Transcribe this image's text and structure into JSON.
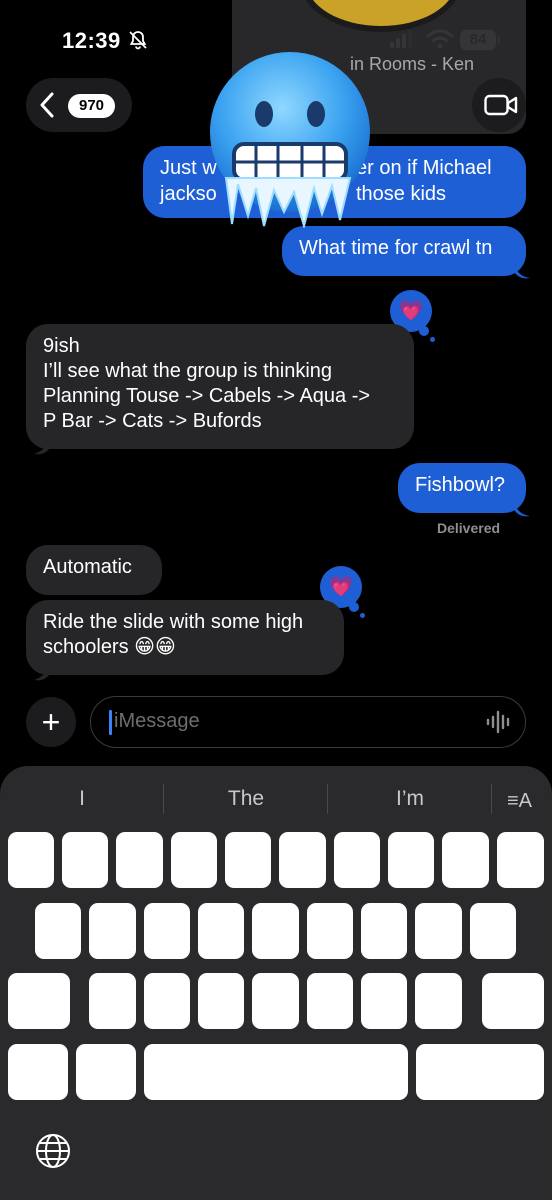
{
  "status_bar": {
    "time": "12:39",
    "battery": "84"
  },
  "shared_video": {
    "title": "in Rooms - Ken"
  },
  "nav": {
    "unread_count": "970"
  },
  "messages": [
    {
      "id": "m1",
      "side": "outgoing",
      "lines": [
        "Just w",
        "er on if Michael",
        "jackso",
        "those kids"
      ]
    },
    {
      "id": "m2",
      "side": "outgoing",
      "text": "What time for crawl tn"
    },
    {
      "id": "m3",
      "side": "incoming",
      "lines": [
        "9ish",
        "I’ll see what the group is thinking",
        "Planning Touse -> Cabels -> Aqua ->",
        "P Bar -> Cats -> Bufords"
      ]
    },
    {
      "id": "m4",
      "side": "outgoing",
      "text": "Fishbowl?"
    },
    {
      "id": "m5",
      "side": "incoming",
      "text": "Automatic"
    },
    {
      "id": "m6",
      "side": "incoming",
      "lines": [
        "Ride the slide with some high",
        "schoolers 😁😁"
      ]
    }
  ],
  "delivered_label": "Delivered",
  "reactions": {
    "heart": "💗"
  },
  "composer": {
    "placeholder": "iMessage",
    "plus": "+"
  },
  "keyboard": {
    "suggestions": [
      "I",
      "The",
      "I’m"
    ],
    "format_icon": "≡A"
  },
  "colors": {
    "outgoing": "#1f5fd6",
    "incoming": "#262628",
    "background": "#000000",
    "keyboard": "#2a2a2c"
  },
  "icons": [
    "bell-slash-icon",
    "signal-icon",
    "wifi-icon",
    "chevron-left-icon",
    "video-camera-icon",
    "plus-icon",
    "waveform-icon",
    "globe-icon",
    "cold-face-emoji"
  ]
}
